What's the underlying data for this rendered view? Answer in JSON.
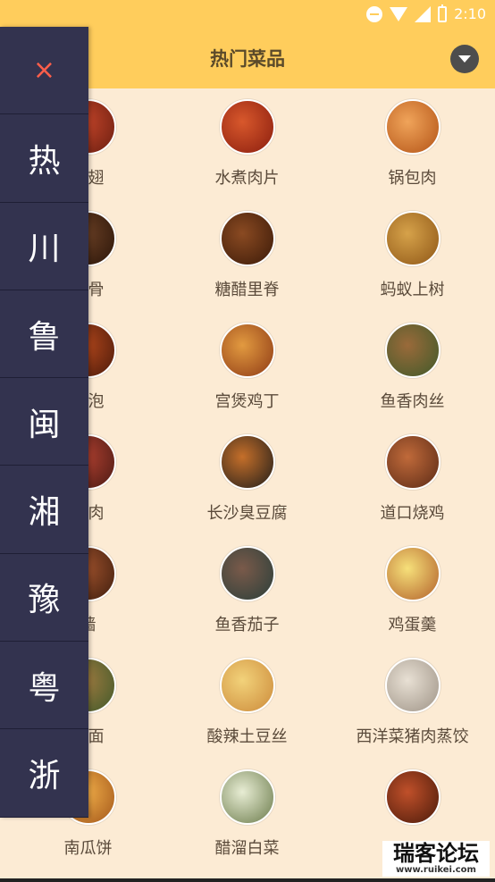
{
  "status": {
    "time": "2:10"
  },
  "header": {
    "title": "热门菜品"
  },
  "drawer": {
    "close": "×",
    "cuisines": [
      "热",
      "川",
      "鲁",
      "闽",
      "湘",
      "豫",
      "粤",
      "浙"
    ]
  },
  "dishes": [
    [
      "鸡翅",
      "水煮肉片",
      "锅包肉"
    ],
    [
      "排骨",
      "糖醋里脊",
      "蚂蚁上树"
    ],
    [
      "筋泡",
      "宫煲鸡丁",
      "鱼香肉丝"
    ],
    [
      "烧肉",
      "长沙臭豆腐",
      "道口烧鸡"
    ],
    [
      "墙",
      "鱼香茄子",
      "鸡蛋羹"
    ],
    [
      "香面",
      "酸辣土豆丝",
      "西洋菜猪肉蒸饺"
    ],
    [
      "南瓜饼",
      "醋溜白菜",
      ""
    ]
  ],
  "watermark": {
    "title": "瑞客论坛",
    "sub": "www.ruikei.com"
  }
}
